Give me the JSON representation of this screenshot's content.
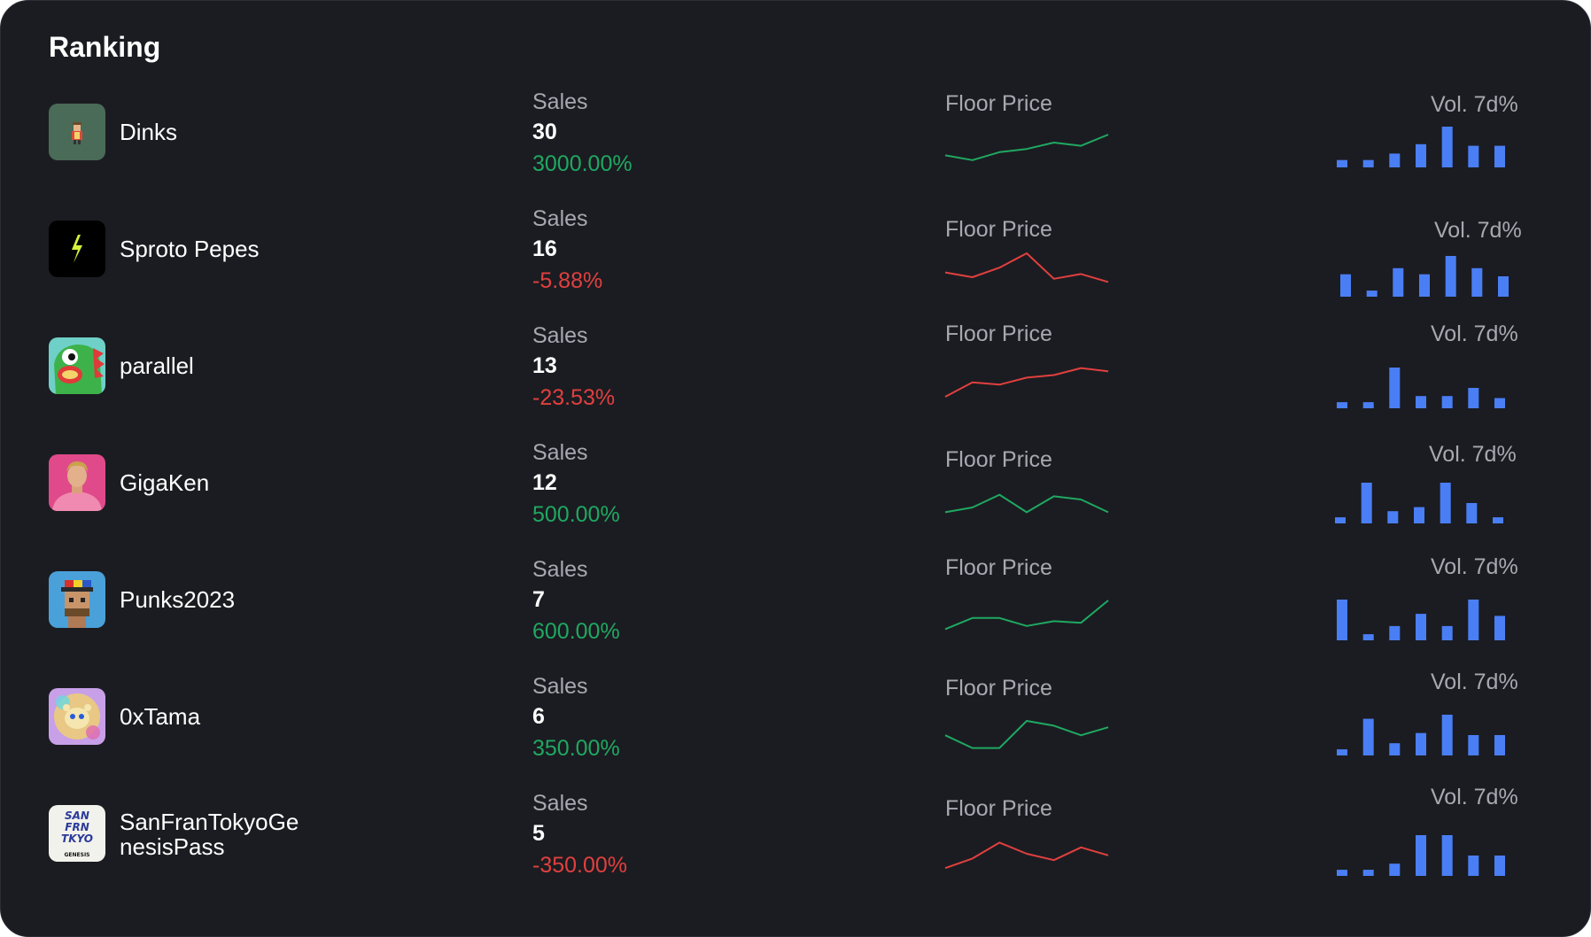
{
  "title": "Ranking",
  "labels": {
    "sales": "Sales",
    "floor": "Floor Price",
    "vol": "Vol. 7d%"
  },
  "colors": {
    "up": "#1fa862",
    "down": "#e0403f",
    "bar": "#4a7ef5"
  },
  "rows": [
    {
      "name": "Dinks",
      "icon": "dink-avatar-icon",
      "sales": "30",
      "change": "3000.00%",
      "trend": "up",
      "floor": [
        0.35,
        0.2,
        0.45,
        0.55,
        0.75,
        0.65,
        1.0
      ],
      "vol": [
        0.18,
        0.18,
        0.34,
        0.57,
        1.0,
        0.53,
        0.53
      ]
    },
    {
      "name": "Sproto Pepes",
      "icon": "sproto-bolt-icon",
      "sales": "16",
      "change": "-5.88%",
      "trend": "down",
      "floor": [
        0.4,
        0.25,
        0.55,
        1.0,
        0.2,
        0.35,
        0.1
      ],
      "vol": [
        0.55,
        0.15,
        0.7,
        0.55,
        1.0,
        0.7,
        0.5
      ]
    },
    {
      "name": "parallel",
      "icon": "parallel-creature-icon",
      "sales": "13",
      "change": "-23.53%",
      "trend": "down",
      "floor": [
        0.0,
        0.45,
        0.38,
        0.6,
        0.68,
        0.9,
        0.8
      ],
      "vol": [
        0.15,
        0.15,
        1.0,
        0.3,
        0.3,
        0.5,
        0.25
      ]
    },
    {
      "name": "GigaKen",
      "icon": "gigaken-avatar-icon",
      "sales": "12",
      "change": "500.00%",
      "trend": "up",
      "floor": [
        0.1,
        0.25,
        0.65,
        0.1,
        0.6,
        0.5,
        0.1
      ],
      "vol": [
        0.15,
        1.0,
        0.3,
        0.4,
        1.0,
        0.5,
        0.15
      ]
    },
    {
      "name": "Punks2023",
      "icon": "punk-avatar-icon",
      "sales": "7",
      "change": "600.00%",
      "trend": "up",
      "floor": [
        0.1,
        0.45,
        0.45,
        0.2,
        0.35,
        0.3,
        1.0
      ],
      "vol": [
        1.0,
        0.15,
        0.35,
        0.65,
        0.35,
        1.0,
        0.6
      ]
    },
    {
      "name": "0xTama",
      "icon": "tama-avatar-icon",
      "sales": "6",
      "change": "350.00%",
      "trend": "up",
      "floor": [
        0.55,
        0.15,
        0.15,
        1.0,
        0.85,
        0.55,
        0.8
      ],
      "vol": [
        0.15,
        0.9,
        0.3,
        0.55,
        1.0,
        0.5,
        0.5
      ]
    },
    {
      "name": "SanFranTokyoGenesisPass",
      "nameLines": [
        "SanFranTokyoGe",
        "nesisPass"
      ],
      "icon": "sanfran-pass-icon",
      "sales": "5",
      "change": "-350.00%",
      "trend": "down",
      "floor": [
        0.05,
        0.35,
        0.85,
        0.5,
        0.3,
        0.7,
        0.45
      ],
      "vol": [
        0.15,
        0.15,
        0.3,
        1.0,
        1.0,
        0.5,
        0.5
      ]
    }
  ]
}
